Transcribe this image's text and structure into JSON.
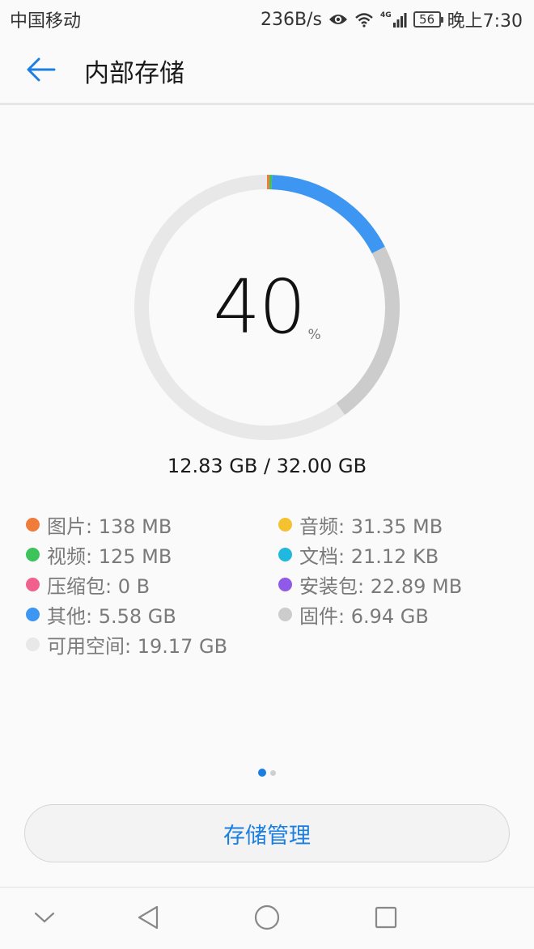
{
  "status_bar": {
    "carrier": "中国移动",
    "net_speed": "236B/s",
    "network_type": "4G",
    "battery": "56",
    "time": "晚上7:30",
    "icons": [
      "eye-icon",
      "wifi-icon",
      "signal-icon",
      "battery-icon"
    ]
  },
  "header": {
    "back_icon": "arrow-left-icon",
    "title": "内部存储"
  },
  "storage": {
    "percent": "40",
    "percent_unit": "%",
    "usage": "12.83 GB / 32.00 GB",
    "ring_colors": {
      "track": "#e8e8e8",
      "other": "#3d97f2",
      "firmware": "#cccccc",
      "pictures": "#f07c3a",
      "videos": "#3cc35a"
    }
  },
  "legend": [
    {
      "label": "图片: 138 MB",
      "color": "#f07c3a"
    },
    {
      "label": "音频: 31.35 MB",
      "color": "#f4c12f"
    },
    {
      "label": "视频: 125 MB",
      "color": "#3cc35a"
    },
    {
      "label": "文档: 21.12 KB",
      "color": "#21b8e0"
    },
    {
      "label": "压缩包: 0 B",
      "color": "#f0628d"
    },
    {
      "label": "安装包: 22.89 MB",
      "color": "#8f5ae8"
    },
    {
      "label": "其他: 5.58 GB",
      "color": "#3d97f2"
    },
    {
      "label": "固件: 6.94 GB",
      "color": "#cccccc"
    },
    {
      "label": "可用空间: 19.17 GB",
      "color": "#e8e8e8"
    }
  ],
  "pager": {
    "active_color": "#1a7fe0"
  },
  "actions": {
    "manage_label": "存储管理",
    "accent_color": "#1a7fe0"
  },
  "nav_bar": {
    "icons": [
      "chevron-down-icon",
      "back-triangle-icon",
      "home-circle-icon",
      "recents-square-icon"
    ]
  }
}
